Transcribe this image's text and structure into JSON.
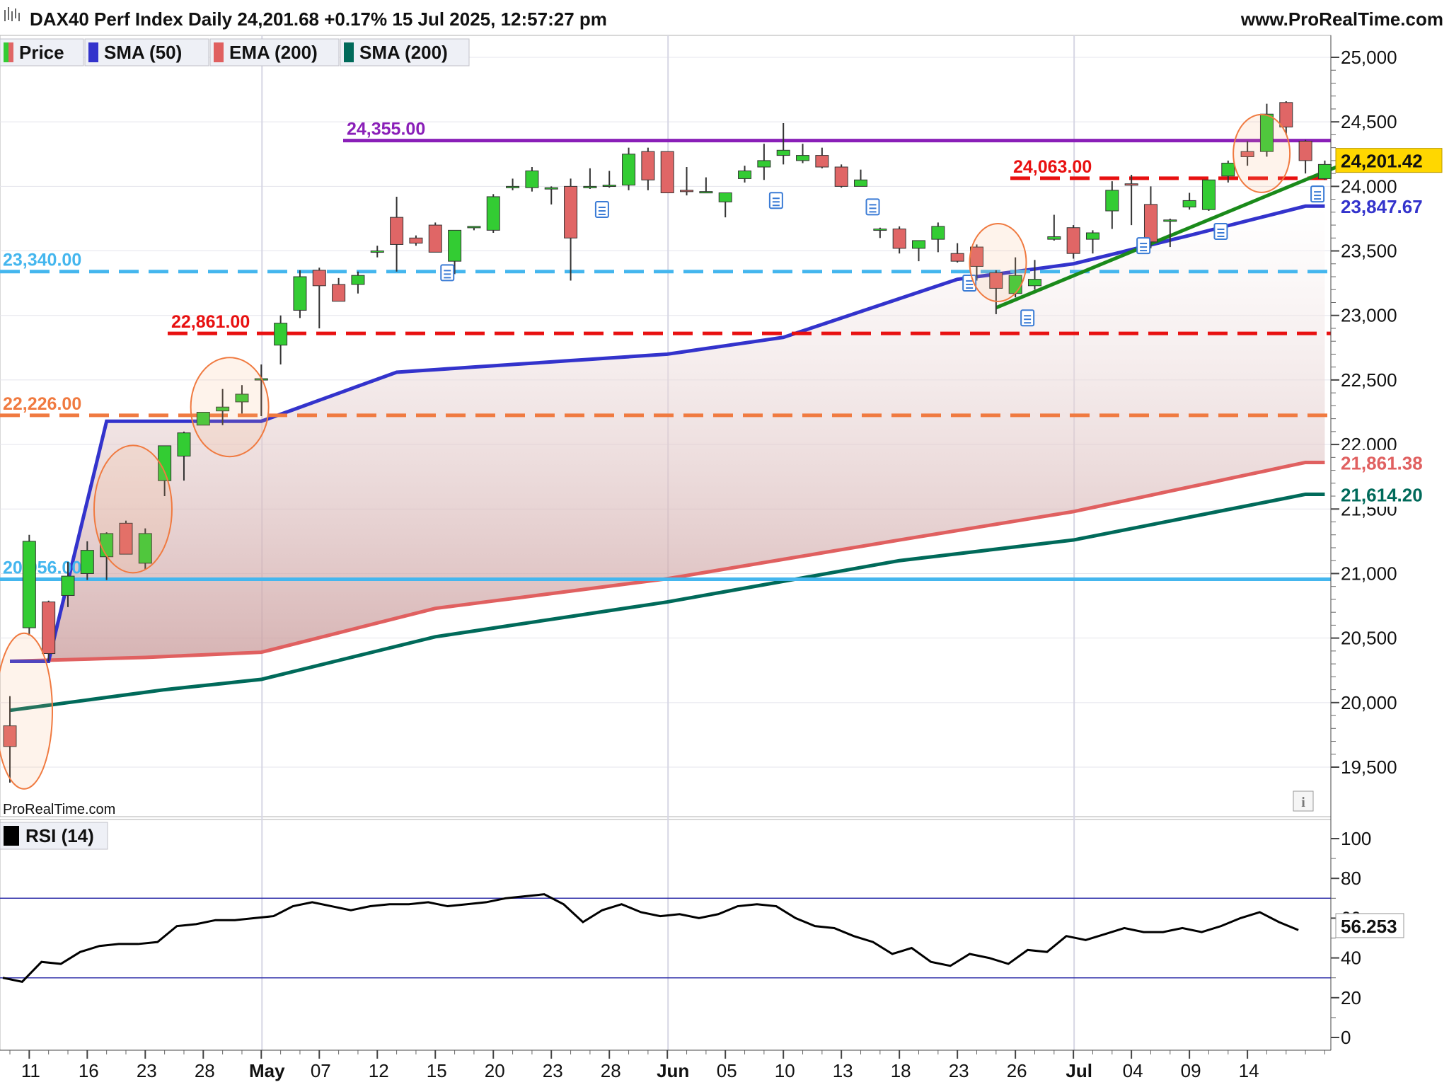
{
  "header": {
    "title": "DAX40 Perf Index Daily 24,201.68 +0.17% 15 Jul 2025, 12:57:27 pm",
    "brand": "www.ProRealTime.com",
    "watermark": "ProRealTime.com",
    "info_icon": "info-icon"
  },
  "legend": [
    {
      "label": "Price",
      "color": "#33cc33",
      "color2": "#e06666",
      "icon": "price-swatch-icon"
    },
    {
      "label": "SMA (50)",
      "color": "#3333cc",
      "icon": "sma50-swatch-icon"
    },
    {
      "label": "EMA (200)",
      "color": "#e06060",
      "icon": "ema200-swatch-icon"
    },
    {
      "label": "SMA (200)",
      "color": "#006a5a",
      "icon": "sma200-swatch-icon"
    }
  ],
  "rsi_legend": {
    "label": "RSI (14)",
    "color": "#000000",
    "icon": "rsi-swatch-icon"
  },
  "colors": {
    "up": "#33cc33",
    "down": "#e06666",
    "sma50": "#3333cc",
    "ema200": "#e06060",
    "sma200": "#006a5a",
    "resistance": "#8a1fb8",
    "trend": "#1a8a1a",
    "red_level": "#e81010",
    "blue_level": "#44b6ee",
    "orange_level": "#f07a40",
    "current_badge": "#ffd700"
  },
  "chart_data": [
    {
      "type": "candlestick",
      "title": "DAX40 Perf Index Daily",
      "y_ticks": [
        "25,000",
        "24,500",
        "24,000",
        "23,500",
        "23,000",
        "22,500",
        "22,000",
        "21,500",
        "21,000",
        "20,500",
        "20,000",
        "19,500"
      ],
      "ylim": [
        19300,
        25200
      ],
      "x_ticks": [
        "11",
        "16",
        "23",
        "28",
        "May",
        "07",
        "12",
        "15",
        "20",
        "23",
        "28",
        "Jun",
        "05",
        "10",
        "13",
        "18",
        "23",
        "26",
        "Jul",
        "04",
        "09",
        "14"
      ],
      "x_tick_bars": [
        1,
        4,
        7,
        10,
        13,
        16,
        19,
        22,
        25,
        28,
        31,
        34,
        37,
        40,
        43,
        46,
        49,
        52,
        55,
        58,
        61,
        64
      ],
      "month_lines_at_bars": [
        13,
        34,
        55
      ],
      "candles": [
        {
          "o": 19820,
          "h": 20050,
          "l": 19380,
          "c": 19660
        },
        {
          "o": 20580,
          "h": 21300,
          "l": 20520,
          "c": 21250
        },
        {
          "o": 20780,
          "h": 20790,
          "l": 20320,
          "c": 20380
        },
        {
          "o": 20830,
          "h": 21090,
          "l": 20740,
          "c": 20980
        },
        {
          "o": 21000,
          "h": 21250,
          "l": 20950,
          "c": 21180
        },
        {
          "o": 21130,
          "h": 21320,
          "l": 20950,
          "c": 21310
        },
        {
          "o": 21390,
          "h": 21410,
          "l": 21150,
          "c": 21150
        },
        {
          "o": 21080,
          "h": 21350,
          "l": 21030,
          "c": 21310
        },
        {
          "o": 21720,
          "h": 21990,
          "l": 21600,
          "c": 21990
        },
        {
          "o": 21910,
          "h": 22100,
          "l": 21720,
          "c": 22090
        },
        {
          "o": 22150,
          "h": 22250,
          "l": 22150,
          "c": 22250
        },
        {
          "o": 22260,
          "h": 22430,
          "l": 22150,
          "c": 22290
        },
        {
          "o": 22330,
          "h": 22460,
          "l": 22240,
          "c": 22390
        },
        {
          "o": 22500,
          "h": 22620,
          "l": 22220,
          "c": 22510
        },
        {
          "o": 22770,
          "h": 23000,
          "l": 22620,
          "c": 22940
        },
        {
          "o": 23040,
          "h": 23350,
          "l": 22980,
          "c": 23300
        },
        {
          "o": 23350,
          "h": 23370,
          "l": 22900,
          "c": 23230
        },
        {
          "o": 23240,
          "h": 23290,
          "l": 23110,
          "c": 23110
        },
        {
          "o": 23240,
          "h": 23340,
          "l": 23170,
          "c": 23310
        },
        {
          "o": 23490,
          "h": 23540,
          "l": 23450,
          "c": 23500
        },
        {
          "o": 23760,
          "h": 23920,
          "l": 23340,
          "c": 23550
        },
        {
          "o": 23600,
          "h": 23620,
          "l": 23540,
          "c": 23560
        },
        {
          "o": 23700,
          "h": 23720,
          "l": 23490,
          "c": 23490
        },
        {
          "o": 23420,
          "h": 23450,
          "l": 23320,
          "c": 23660
        },
        {
          "o": 23680,
          "h": 23690,
          "l": 23660,
          "c": 23690
        },
        {
          "o": 23660,
          "h": 23940,
          "l": 23640,
          "c": 23920
        },
        {
          "o": 23990,
          "h": 24060,
          "l": 23970,
          "c": 24000
        },
        {
          "o": 23990,
          "h": 24150,
          "l": 23960,
          "c": 24120
        },
        {
          "o": 23990,
          "h": 24000,
          "l": 23860,
          "c": 23990
        },
        {
          "o": 24000,
          "h": 24060,
          "l": 23270,
          "c": 23600
        },
        {
          "o": 23990,
          "h": 24140,
          "l": 23980,
          "c": 24000
        },
        {
          "o": 24000,
          "h": 24120,
          "l": 23990,
          "c": 24010
        },
        {
          "o": 24010,
          "h": 24300,
          "l": 23970,
          "c": 24250
        },
        {
          "o": 24270,
          "h": 24300,
          "l": 23970,
          "c": 24050
        },
        {
          "o": 24270,
          "h": 24270,
          "l": 23960,
          "c": 23950
        },
        {
          "o": 23970,
          "h": 24150,
          "l": 23930,
          "c": 23960
        },
        {
          "o": 23960,
          "h": 24070,
          "l": 23950,
          "c": 23960
        },
        {
          "o": 23880,
          "h": 23950,
          "l": 23760,
          "c": 23950
        },
        {
          "o": 24060,
          "h": 24160,
          "l": 24030,
          "c": 24120
        },
        {
          "o": 24150,
          "h": 24330,
          "l": 24050,
          "c": 24200
        },
        {
          "o": 24240,
          "h": 24490,
          "l": 24170,
          "c": 24280
        },
        {
          "o": 24200,
          "h": 24330,
          "l": 24180,
          "c": 24240
        },
        {
          "o": 24240,
          "h": 24300,
          "l": 24140,
          "c": 24150
        },
        {
          "o": 24150,
          "h": 24170,
          "l": 23990,
          "c": 24000
        },
        {
          "o": 24000,
          "h": 24130,
          "l": 24000,
          "c": 24050
        },
        {
          "o": 23670,
          "h": 23680,
          "l": 23600,
          "c": 23670
        },
        {
          "o": 23670,
          "h": 23690,
          "l": 23480,
          "c": 23520
        },
        {
          "o": 23520,
          "h": 23570,
          "l": 23420,
          "c": 23580
        },
        {
          "o": 23590,
          "h": 23720,
          "l": 23490,
          "c": 23690
        },
        {
          "o": 23480,
          "h": 23560,
          "l": 23410,
          "c": 23420
        },
        {
          "o": 23530,
          "h": 23550,
          "l": 23270,
          "c": 23380
        },
        {
          "o": 23330,
          "h": 23350,
          "l": 23010,
          "c": 23210
        },
        {
          "o": 23170,
          "h": 23450,
          "l": 23140,
          "c": 23310
        },
        {
          "o": 23230,
          "h": 23430,
          "l": 23200,
          "c": 23280
        },
        {
          "o": 23590,
          "h": 23780,
          "l": 23580,
          "c": 23610
        },
        {
          "o": 23680,
          "h": 23700,
          "l": 23440,
          "c": 23480
        },
        {
          "o": 23590,
          "h": 23660,
          "l": 23480,
          "c": 23640
        },
        {
          "o": 23810,
          "h": 24040,
          "l": 23670,
          "c": 23970
        },
        {
          "o": 24020,
          "h": 24090,
          "l": 23700,
          "c": 24010
        },
        {
          "o": 23860,
          "h": 24000,
          "l": 23520,
          "c": 23570
        },
        {
          "o": 23730,
          "h": 23750,
          "l": 23530,
          "c": 23740
        },
        {
          "o": 23840,
          "h": 23950,
          "l": 23820,
          "c": 23890
        },
        {
          "o": 23820,
          "h": 24000,
          "l": 23810,
          "c": 24050
        },
        {
          "o": 24080,
          "h": 24200,
          "l": 24030,
          "c": 24180
        },
        {
          "o": 24270,
          "h": 24350,
          "l": 24160,
          "c": 24230
        },
        {
          "o": 24270,
          "h": 24640,
          "l": 24230,
          "c": 24560
        },
        {
          "o": 24650,
          "h": 24660,
          "l": 24400,
          "c": 24460
        },
        {
          "o": 24350,
          "h": 24360,
          "l": 24100,
          "c": 24200
        },
        {
          "o": 24060,
          "h": 24200,
          "l": 24050,
          "c": 24170
        }
      ],
      "sma50": [
        [
          0,
          20320
        ],
        [
          2,
          20320
        ],
        [
          5,
          22180
        ],
        [
          13,
          22180
        ],
        [
          20,
          22560
        ],
        [
          34,
          22700
        ],
        [
          40,
          22830
        ],
        [
          49,
          23280
        ],
        [
          55,
          23400
        ],
        [
          61,
          23620
        ],
        [
          67,
          23847
        ]
      ],
      "ema200": [
        [
          0,
          20320
        ],
        [
          7,
          20350
        ],
        [
          13,
          20390
        ],
        [
          22,
          20730
        ],
        [
          34,
          20960
        ],
        [
          46,
          21260
        ],
        [
          55,
          21480
        ],
        [
          67,
          21861
        ]
      ],
      "sma200": [
        [
          0,
          19940
        ],
        [
          8,
          20100
        ],
        [
          13,
          20180
        ],
        [
          22,
          20510
        ],
        [
          34,
          20780
        ],
        [
          46,
          21100
        ],
        [
          55,
          21260
        ],
        [
          67,
          21614
        ]
      ],
      "levels": [
        {
          "value": 24355,
          "label": "24,355.00",
          "color_key": "resistance",
          "style": "solid"
        },
        {
          "value": 24063,
          "label": "24,063.00",
          "color_key": "red_level",
          "style": "dashed"
        },
        {
          "value": 23340,
          "label": "23,340.00",
          "color_key": "blue_level",
          "style": "dashed"
        },
        {
          "value": 22861,
          "label": "22,861.00",
          "color_key": "red_level",
          "style": "dashed"
        },
        {
          "value": 22226,
          "label": "22,226.00",
          "color_key": "orange_level",
          "style": "dashed"
        },
        {
          "value": 20956,
          "label": "20,956.00",
          "color_key": "blue_level",
          "style": "solid"
        }
      ],
      "badges": [
        {
          "value": 24201.42,
          "label": "24,201.42"
        },
        {
          "value": 23847.67,
          "label": "23,847.67"
        },
        {
          "value": 21861.38,
          "label": "21,861.38"
        },
        {
          "value": 21614.2,
          "label": "21,614.20"
        }
      ],
      "trendline": {
        "from": [
          51,
          23060
        ],
        "to": [
          69,
          24220
        ]
      },
      "circles_at_bars": [
        0,
        6,
        11,
        50,
        64
      ]
    },
    {
      "type": "line",
      "title": "RSI (14)",
      "y_ticks": [
        "100",
        "80",
        "60",
        "40",
        "20",
        "0"
      ],
      "ylim": [
        0,
        100
      ],
      "bands": [
        70,
        30
      ],
      "current": {
        "value": 56.253,
        "label": "56.253"
      },
      "values": [
        30,
        28,
        38,
        37,
        43,
        46,
        47,
        47,
        48,
        56,
        57,
        59,
        59,
        60,
        61,
        66,
        68,
        66,
        64,
        66,
        67,
        67,
        68,
        66,
        67,
        68,
        70,
        71,
        72,
        67,
        58,
        64,
        67,
        63,
        61,
        62,
        60,
        62,
        66,
        67,
        66,
        60,
        56,
        55,
        51,
        48,
        42,
        45,
        38,
        36,
        42,
        40,
        37,
        44,
        43,
        51,
        49,
        52,
        55,
        53,
        53,
        55,
        53,
        56,
        60,
        63,
        58,
        54
      ]
    }
  ]
}
